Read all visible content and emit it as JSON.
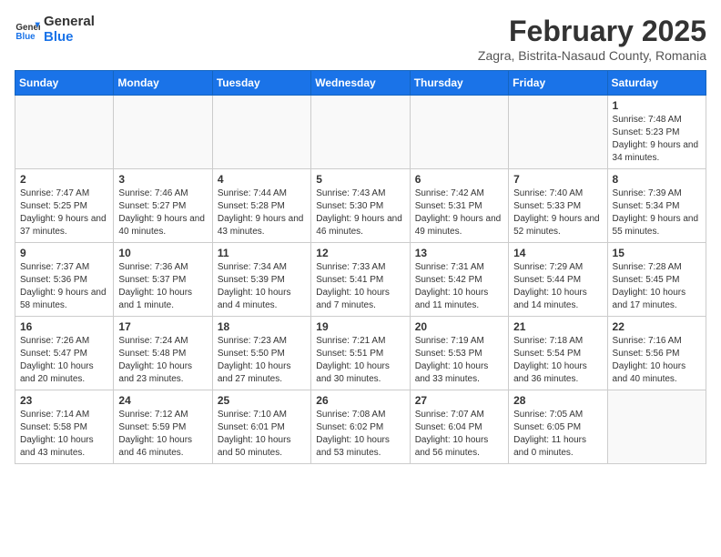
{
  "header": {
    "logo_line1": "General",
    "logo_line2": "Blue",
    "month": "February 2025",
    "location": "Zagra, Bistrita-Nasaud County, Romania"
  },
  "days_of_week": [
    "Sunday",
    "Monday",
    "Tuesday",
    "Wednesday",
    "Thursday",
    "Friday",
    "Saturday"
  ],
  "weeks": [
    [
      {
        "day": "",
        "info": ""
      },
      {
        "day": "",
        "info": ""
      },
      {
        "day": "",
        "info": ""
      },
      {
        "day": "",
        "info": ""
      },
      {
        "day": "",
        "info": ""
      },
      {
        "day": "",
        "info": ""
      },
      {
        "day": "1",
        "info": "Sunrise: 7:48 AM\nSunset: 5:23 PM\nDaylight: 9 hours and 34 minutes."
      }
    ],
    [
      {
        "day": "2",
        "info": "Sunrise: 7:47 AM\nSunset: 5:25 PM\nDaylight: 9 hours and 37 minutes."
      },
      {
        "day": "3",
        "info": "Sunrise: 7:46 AM\nSunset: 5:27 PM\nDaylight: 9 hours and 40 minutes."
      },
      {
        "day": "4",
        "info": "Sunrise: 7:44 AM\nSunset: 5:28 PM\nDaylight: 9 hours and 43 minutes."
      },
      {
        "day": "5",
        "info": "Sunrise: 7:43 AM\nSunset: 5:30 PM\nDaylight: 9 hours and 46 minutes."
      },
      {
        "day": "6",
        "info": "Sunrise: 7:42 AM\nSunset: 5:31 PM\nDaylight: 9 hours and 49 minutes."
      },
      {
        "day": "7",
        "info": "Sunrise: 7:40 AM\nSunset: 5:33 PM\nDaylight: 9 hours and 52 minutes."
      },
      {
        "day": "8",
        "info": "Sunrise: 7:39 AM\nSunset: 5:34 PM\nDaylight: 9 hours and 55 minutes."
      }
    ],
    [
      {
        "day": "9",
        "info": "Sunrise: 7:37 AM\nSunset: 5:36 PM\nDaylight: 9 hours and 58 minutes."
      },
      {
        "day": "10",
        "info": "Sunrise: 7:36 AM\nSunset: 5:37 PM\nDaylight: 10 hours and 1 minute."
      },
      {
        "day": "11",
        "info": "Sunrise: 7:34 AM\nSunset: 5:39 PM\nDaylight: 10 hours and 4 minutes."
      },
      {
        "day": "12",
        "info": "Sunrise: 7:33 AM\nSunset: 5:41 PM\nDaylight: 10 hours and 7 minutes."
      },
      {
        "day": "13",
        "info": "Sunrise: 7:31 AM\nSunset: 5:42 PM\nDaylight: 10 hours and 11 minutes."
      },
      {
        "day": "14",
        "info": "Sunrise: 7:29 AM\nSunset: 5:44 PM\nDaylight: 10 hours and 14 minutes."
      },
      {
        "day": "15",
        "info": "Sunrise: 7:28 AM\nSunset: 5:45 PM\nDaylight: 10 hours and 17 minutes."
      }
    ],
    [
      {
        "day": "16",
        "info": "Sunrise: 7:26 AM\nSunset: 5:47 PM\nDaylight: 10 hours and 20 minutes."
      },
      {
        "day": "17",
        "info": "Sunrise: 7:24 AM\nSunset: 5:48 PM\nDaylight: 10 hours and 23 minutes."
      },
      {
        "day": "18",
        "info": "Sunrise: 7:23 AM\nSunset: 5:50 PM\nDaylight: 10 hours and 27 minutes."
      },
      {
        "day": "19",
        "info": "Sunrise: 7:21 AM\nSunset: 5:51 PM\nDaylight: 10 hours and 30 minutes."
      },
      {
        "day": "20",
        "info": "Sunrise: 7:19 AM\nSunset: 5:53 PM\nDaylight: 10 hours and 33 minutes."
      },
      {
        "day": "21",
        "info": "Sunrise: 7:18 AM\nSunset: 5:54 PM\nDaylight: 10 hours and 36 minutes."
      },
      {
        "day": "22",
        "info": "Sunrise: 7:16 AM\nSunset: 5:56 PM\nDaylight: 10 hours and 40 minutes."
      }
    ],
    [
      {
        "day": "23",
        "info": "Sunrise: 7:14 AM\nSunset: 5:58 PM\nDaylight: 10 hours and 43 minutes."
      },
      {
        "day": "24",
        "info": "Sunrise: 7:12 AM\nSunset: 5:59 PM\nDaylight: 10 hours and 46 minutes."
      },
      {
        "day": "25",
        "info": "Sunrise: 7:10 AM\nSunset: 6:01 PM\nDaylight: 10 hours and 50 minutes."
      },
      {
        "day": "26",
        "info": "Sunrise: 7:08 AM\nSunset: 6:02 PM\nDaylight: 10 hours and 53 minutes."
      },
      {
        "day": "27",
        "info": "Sunrise: 7:07 AM\nSunset: 6:04 PM\nDaylight: 10 hours and 56 minutes."
      },
      {
        "day": "28",
        "info": "Sunrise: 7:05 AM\nSunset: 6:05 PM\nDaylight: 11 hours and 0 minutes."
      },
      {
        "day": "",
        "info": ""
      }
    ]
  ]
}
